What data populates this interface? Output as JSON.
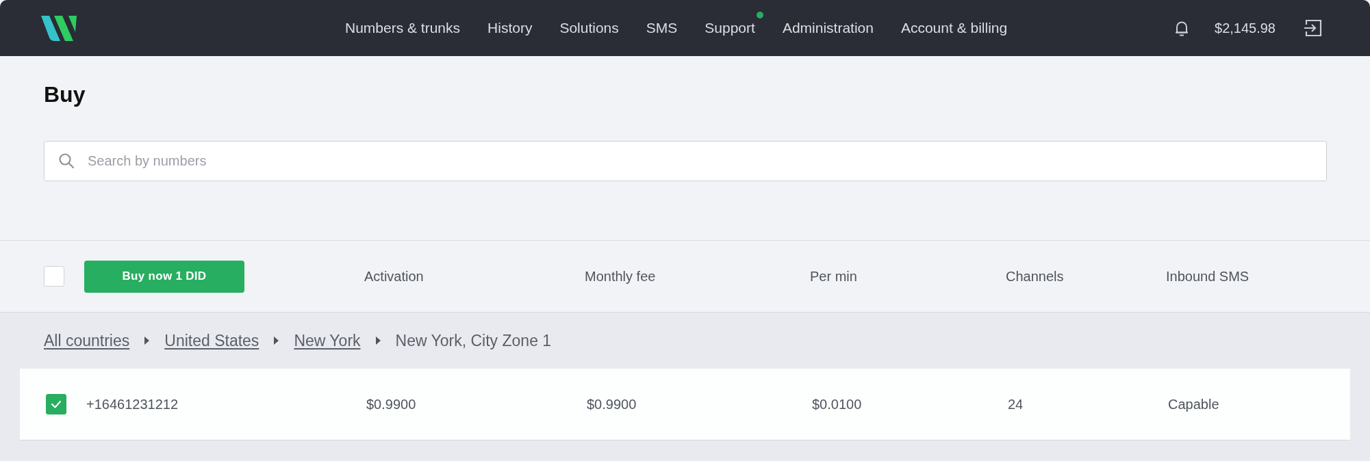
{
  "header": {
    "nav": [
      {
        "label": "Numbers & trunks",
        "notification": false
      },
      {
        "label": "History",
        "notification": false
      },
      {
        "label": "Solutions",
        "notification": false
      },
      {
        "label": "SMS",
        "notification": false
      },
      {
        "label": "Support",
        "notification": true
      },
      {
        "label": "Administration",
        "notification": false
      },
      {
        "label": "Account & billing",
        "notification": false
      }
    ],
    "balance": "$2,145.98"
  },
  "page": {
    "title": "Buy"
  },
  "search": {
    "placeholder": "Search by numbers"
  },
  "toolbar": {
    "select_all": {
      "checked": false
    },
    "buy_button": "Buy now 1 DID",
    "columns": [
      "Activation",
      "Monthly fee",
      "Per min",
      "Channels",
      "Inbound SMS"
    ]
  },
  "breadcrumb": [
    {
      "label": "All countries",
      "kind": "link"
    },
    {
      "label": "United States",
      "kind": "link"
    },
    {
      "label": "New York",
      "kind": "link"
    },
    {
      "label": "New York, City Zone 1",
      "kind": "current"
    }
  ],
  "rows": [
    {
      "checked": true,
      "number": "+16461231212",
      "activation": "$0.9900",
      "monthly_fee": "$0.9900",
      "per_min": "$0.0100",
      "channels": "24",
      "inbound_sms": "Capable"
    }
  ]
}
